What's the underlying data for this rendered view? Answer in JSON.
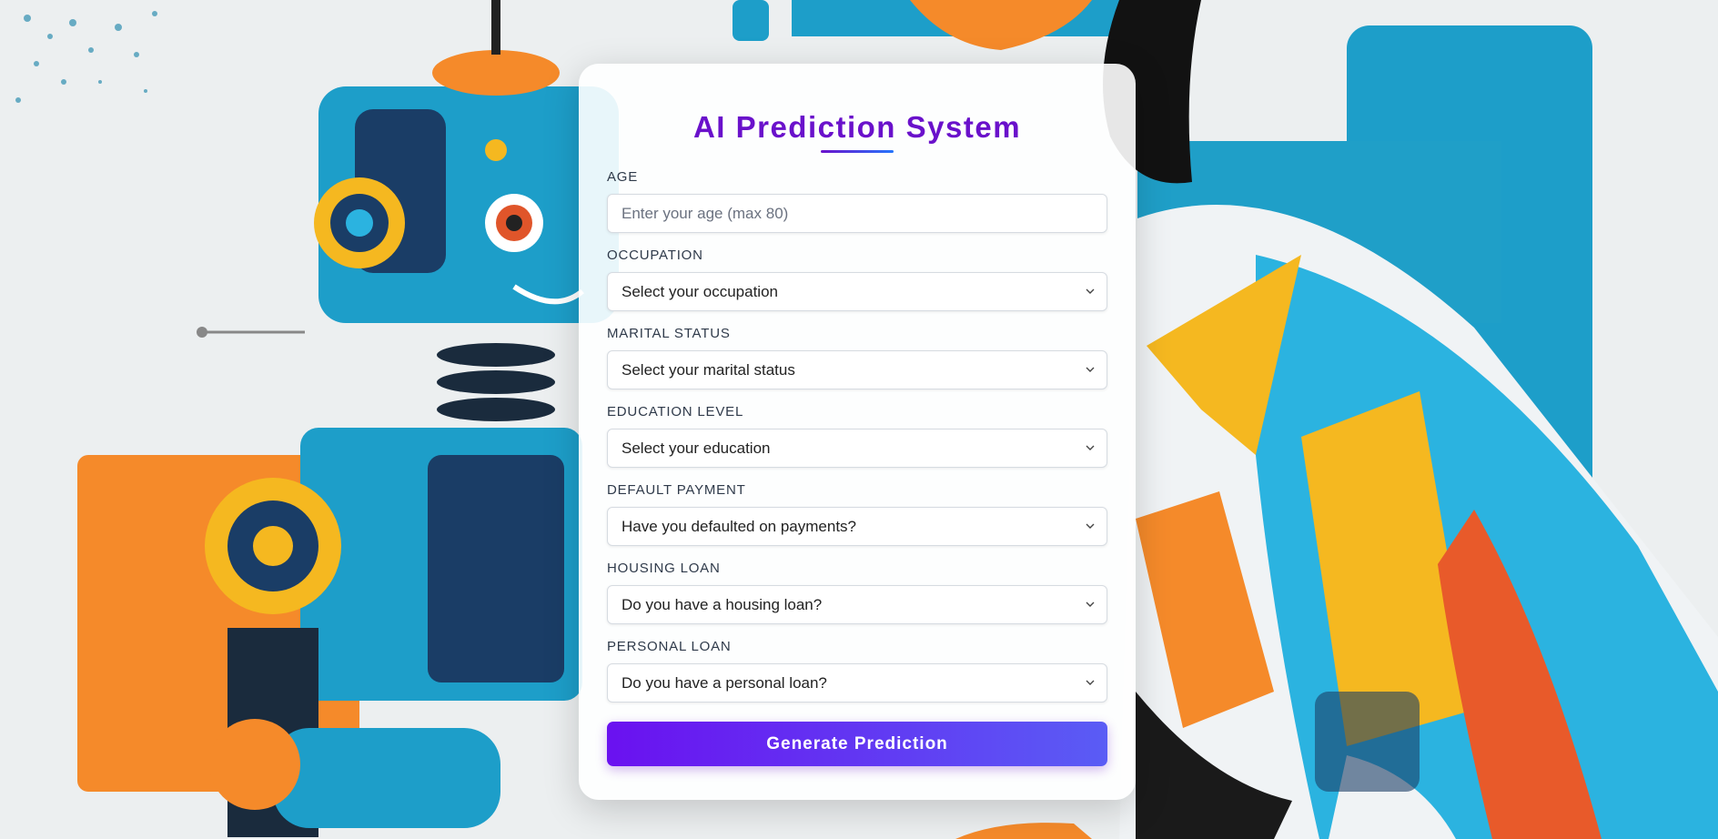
{
  "form": {
    "title": "AI Prediction System",
    "submit_label": "Generate Prediction",
    "fields": [
      {
        "label": "AGE",
        "type": "input",
        "placeholder": "Enter your age (max 80)",
        "value": ""
      },
      {
        "label": "OCCUPATION",
        "type": "select",
        "selected": "Select your occupation"
      },
      {
        "label": "MARITAL STATUS",
        "type": "select",
        "selected": "Select your marital status"
      },
      {
        "label": "EDUCATION LEVEL",
        "type": "select",
        "selected": "Select your education"
      },
      {
        "label": "DEFAULT PAYMENT",
        "type": "select",
        "selected": "Have you defaulted on payments?"
      },
      {
        "label": "HOUSING LOAN",
        "type": "select",
        "selected": "Do you have a housing loan?"
      },
      {
        "label": "PERSONAL LOAN",
        "type": "select",
        "selected": "Do you have a personal loan?"
      }
    ]
  },
  "colors": {
    "accent": "#6a11cb",
    "button_gradient_start": "#6a11f0",
    "button_gradient_end": "#5a5cf5"
  },
  "icons": {
    "select_arrow": "chevron-down-icon"
  }
}
